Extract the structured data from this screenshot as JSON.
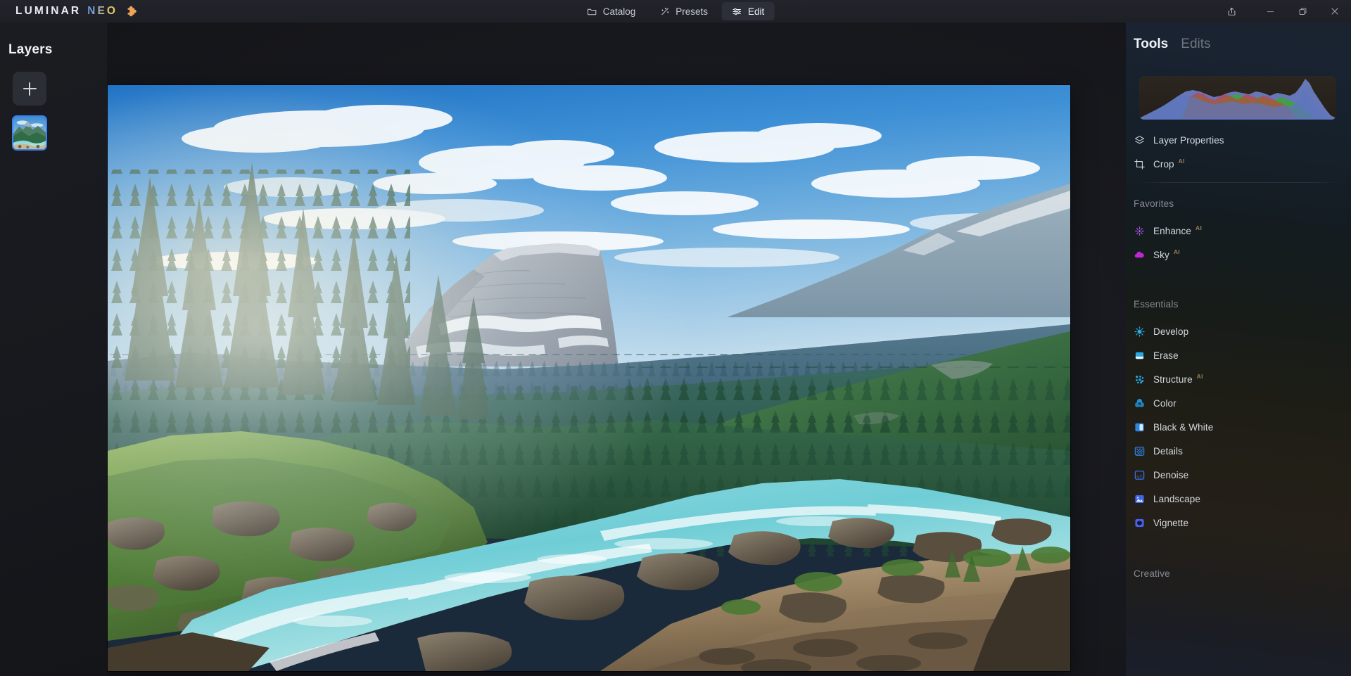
{
  "app": {
    "brand_primary": "LUMINAR",
    "brand_secondary": "NEO",
    "brand_plugin_icon": "puzzle-piece-icon"
  },
  "titlebar": {
    "nav": [
      {
        "label": "Catalog",
        "icon": "folder-icon",
        "active": false
      },
      {
        "label": "Presets",
        "icon": "magic-wand-icon",
        "active": false
      },
      {
        "label": "Edit",
        "icon": "sliders-icon",
        "active": true
      }
    ],
    "window_controls": [
      {
        "name": "share-button",
        "icon": "share-icon"
      },
      {
        "name": "minimize-button",
        "icon": "minimize-icon"
      },
      {
        "name": "maximize-button",
        "icon": "restore-icon"
      },
      {
        "name": "close-button",
        "icon": "close-icon"
      }
    ]
  },
  "layers": {
    "title": "Layers",
    "add_label": "+",
    "thumbnail_name": "layer-thumbnail-mountain-river"
  },
  "tools": {
    "tabs": [
      {
        "label": "Tools",
        "active": true
      },
      {
        "label": "Edits",
        "active": false
      }
    ],
    "histogram": {
      "name": "rgb-histogram",
      "channels": [
        "red",
        "green",
        "blue"
      ]
    },
    "top_items": [
      {
        "label": "Layer Properties",
        "icon": "layers-icon",
        "ai": "",
        "color": "#d4d9e1"
      },
      {
        "label": "Crop",
        "icon": "crop-icon",
        "ai": "AI",
        "color": "#d4d9e1"
      }
    ],
    "sections": [
      {
        "title": "Favorites",
        "items": [
          {
            "label": "Enhance",
            "icon": "sparkle-burst-icon",
            "ai": "AI",
            "color": "#a855f7"
          },
          {
            "label": "Sky",
            "icon": "cloud-icon",
            "ai": "AI",
            "color": "#c026d3"
          }
        ]
      },
      {
        "title": "Essentials",
        "items": [
          {
            "label": "Develop",
            "icon": "sun-icon",
            "ai": "",
            "color": "#27a9e1"
          },
          {
            "label": "Erase",
            "icon": "eraser-icon",
            "ai": "",
            "color": "#27a9e1"
          },
          {
            "label": "Structure",
            "icon": "dots-grid-icon",
            "ai": "AI",
            "color": "#27a9e1"
          },
          {
            "label": "Color",
            "icon": "color-wheel-icon",
            "ai": "",
            "color": "#2196dd"
          },
          {
            "label": "Black & White",
            "icon": "contrast-square-icon",
            "ai": "",
            "color": "#2b86e0"
          },
          {
            "label": "Details",
            "icon": "checker-grid-icon",
            "ai": "",
            "color": "#2f7fe2"
          },
          {
            "label": "Denoise",
            "icon": "noise-square-icon",
            "ai": "",
            "color": "#3a6fe6"
          },
          {
            "label": "Landscape",
            "icon": "image-mountain-icon",
            "ai": "",
            "color": "#3f66e8"
          },
          {
            "label": "Vignette",
            "icon": "vignette-icon",
            "ai": "",
            "color": "#4a5fea"
          }
        ]
      },
      {
        "title": "Creative",
        "items": []
      }
    ]
  },
  "colors": {
    "accent_blue": "#3b82f6",
    "panel_bg": "#1a1c21",
    "titlebar_bg": "#22242b",
    "text_primary": "#eef1f6",
    "text_muted": "#848a94",
    "ai_badge": "#9a7d55"
  }
}
